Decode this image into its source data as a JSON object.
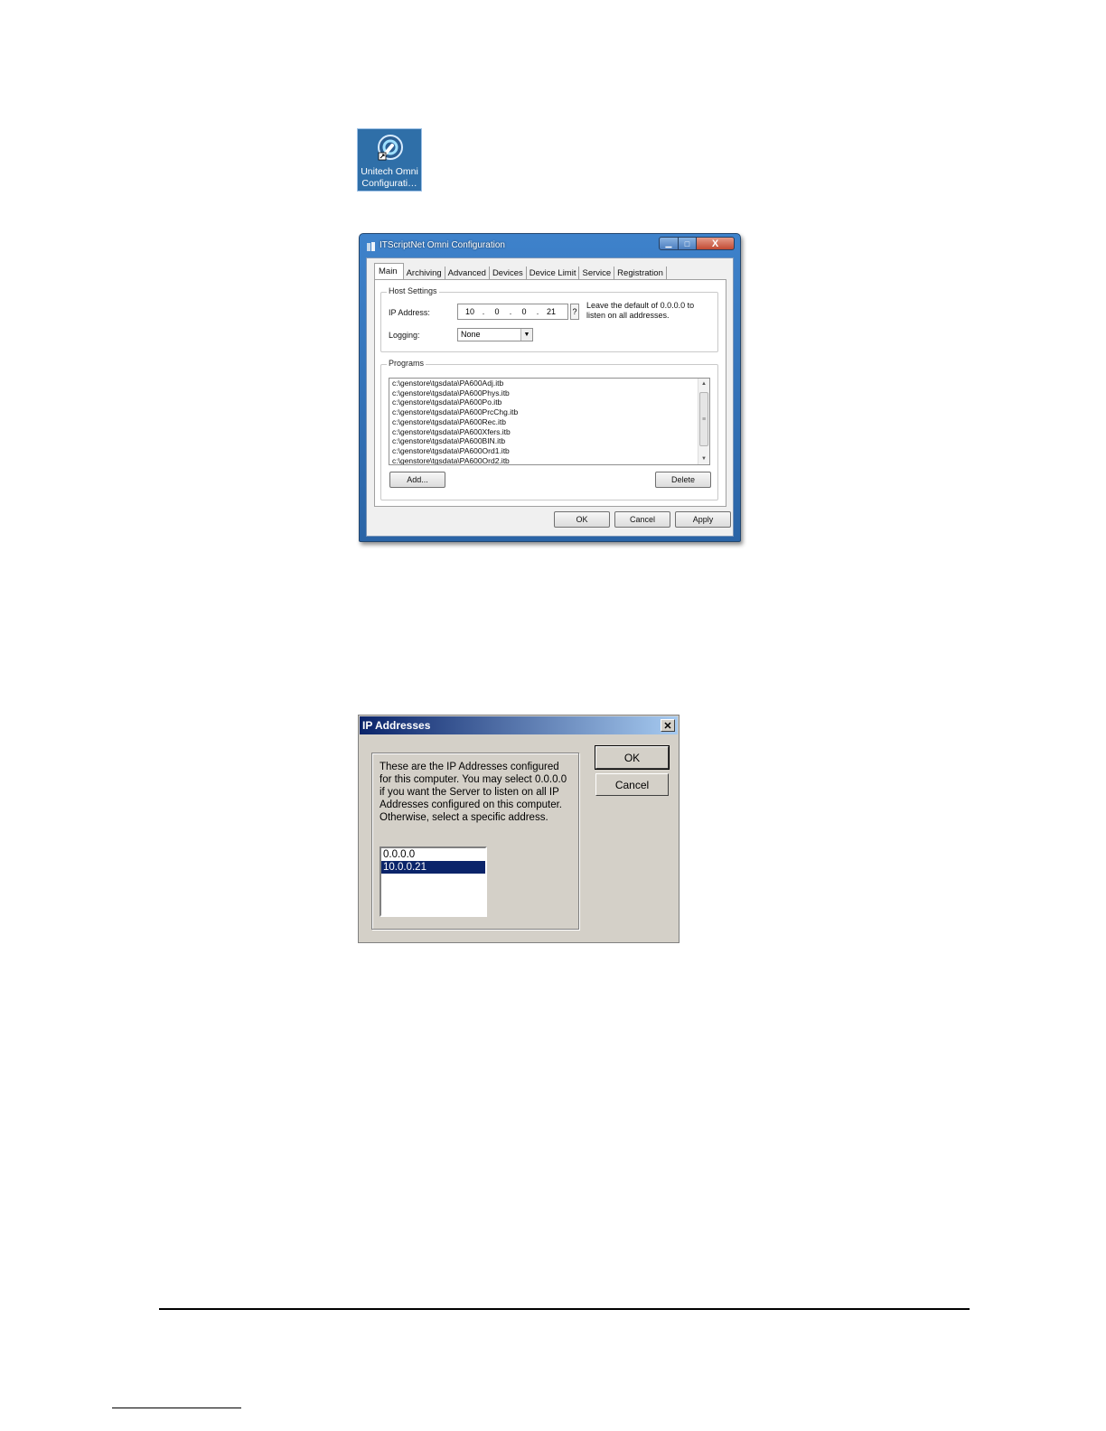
{
  "desktop_icon": {
    "label_line1": "Unitech Omni",
    "label_line2": "Configurati…",
    "icon": "wrench-gear-icon"
  },
  "config_window": {
    "title": "ITScriptNet Omni Configuration",
    "controls": {
      "minimize": "▁",
      "maximize": "□",
      "close": "X"
    },
    "tabs": [
      "Main",
      "Archiving",
      "Advanced",
      "Devices",
      "Device Limit",
      "Service",
      "Registration"
    ],
    "active_tab": "Main",
    "host_settings": {
      "group_label": "Host Settings",
      "ip_label": "IP Address:",
      "ip_octets": [
        "10",
        "0",
        "0",
        "21"
      ],
      "ip_help_button": "?",
      "ip_hint": "Leave the default of 0.0.0.0 to listen on all addresses.",
      "logging_label": "Logging:",
      "logging_value": "None"
    },
    "programs": {
      "group_label": "Programs",
      "items": [
        "c:\\genstore\\tgsdata\\PA600Adj.itb",
        "c:\\genstore\\tgsdata\\PA600Phys.itb",
        "c:\\genstore\\tgsdata\\PA600Po.itb",
        "c:\\genstore\\tgsdata\\PA600PrcChg.itb",
        "c:\\genstore\\tgsdata\\PA600Rec.itb",
        "c:\\genstore\\tgsdata\\PA600Xfers.itb",
        "c:\\genstore\\tgsdata\\PA600BIN.itb",
        "c:\\genstore\\tgsdata\\PA600Ord1.itb",
        "c:\\genstore\\tgsdata\\PA600Ord2.itb"
      ],
      "add_button": "Add...",
      "delete_button": "Delete"
    },
    "buttons": {
      "ok": "OK",
      "cancel": "Cancel",
      "apply": "Apply"
    }
  },
  "ip_dialog": {
    "title": "IP Addresses",
    "close": "✕",
    "description": "These are the IP Addresses configured for this computer.  You may select 0.0.0.0 if you want the Server to listen on all IP Addresses configured on this computer.  Otherwise, select a specific address.",
    "addresses": [
      "0.0.0.0",
      "10.0.0.21"
    ],
    "selected": "10.0.0.21",
    "ok": "OK",
    "cancel": "Cancel"
  },
  "colors": {
    "classic_titlebar_start": "#0a246a",
    "classic_titlebar_end": "#a6caf0",
    "classic_face": "#d4d0c8",
    "aero_frame": "#3e82cb"
  }
}
